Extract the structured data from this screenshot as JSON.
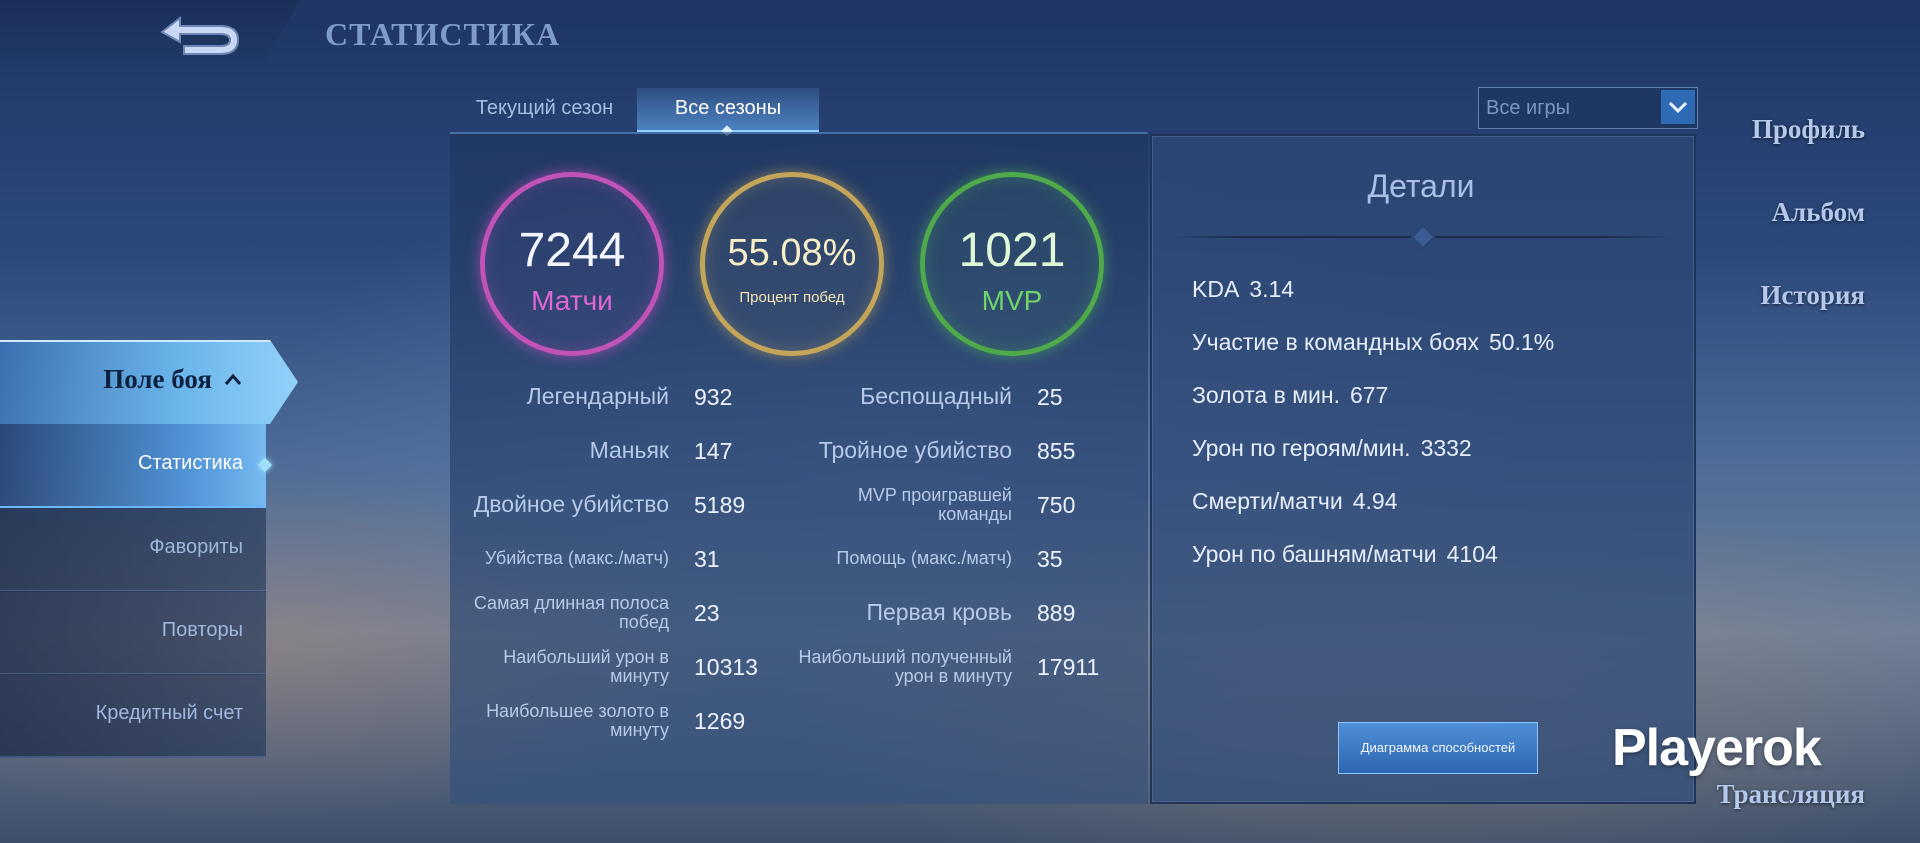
{
  "header": {
    "title": "СТАТИСТИКА",
    "back_icon": "back-arrow-icon"
  },
  "sidebar": {
    "items": [
      {
        "label": "Профиль"
      },
      {
        "label": "Альбом"
      },
      {
        "label": "История"
      },
      {
        "label": "Поле боя"
      },
      {
        "label": "Трансляция"
      }
    ],
    "subitems": [
      {
        "label": "Статистика"
      },
      {
        "label": "Фавориты"
      },
      {
        "label": "Повторы"
      },
      {
        "label": "Кредитный счет"
      }
    ]
  },
  "tabs": [
    {
      "label": "Текущий сезон"
    },
    {
      "label": "Все сезоны"
    }
  ],
  "filter": {
    "value": "Все игры"
  },
  "summary": {
    "matches": {
      "value": "7244",
      "label": "Матчи",
      "color": "#c153b8"
    },
    "winrate": {
      "value": "55.08%",
      "label": "Процент побед",
      "color": "#c4a65a"
    },
    "mvp": {
      "value": "1021",
      "label": "MVP",
      "color": "#4eaa4a"
    }
  },
  "stats_left": [
    {
      "label": "Легендарный",
      "value": "932"
    },
    {
      "label": "Маньяк",
      "value": "147"
    },
    {
      "label": "Двойное убийство",
      "value": "5189"
    },
    {
      "label": "Убийства (макс./матч)",
      "value": "31"
    },
    {
      "label": "Самая длинная полоса побед",
      "value": "23"
    },
    {
      "label": "Наибольший урон в минуту",
      "value": "10313"
    },
    {
      "label": "Наибольшее золото в минуту",
      "value": "1269"
    }
  ],
  "stats_right": [
    {
      "label": "Беспощадный",
      "value": "25"
    },
    {
      "label": "Тройное убийство",
      "value": "855"
    },
    {
      "label": "MVP проигравшей команды",
      "value": "750"
    },
    {
      "label": "Помощь (макс./матч)",
      "value": "35"
    },
    {
      "label": "Первая кровь",
      "value": "889"
    },
    {
      "label": "Наибольший полученный урон в минуту",
      "value": "17911"
    }
  ],
  "details": {
    "title": "Детали",
    "rows": [
      {
        "label": "KDA",
        "value": "3.14"
      },
      {
        "label": "Участие в командных боях",
        "value": "50.1%"
      },
      {
        "label": "Золота в мин.",
        "value": "677"
      },
      {
        "label": "Урон по героям/мин.",
        "value": "3332"
      },
      {
        "label": "Смерти/матчи",
        "value": "4.94"
      },
      {
        "label": "Урон по башням/матчи",
        "value": "4104"
      }
    ],
    "chart_button": "Диаграмма способностей"
  },
  "watermark": "Playerok"
}
